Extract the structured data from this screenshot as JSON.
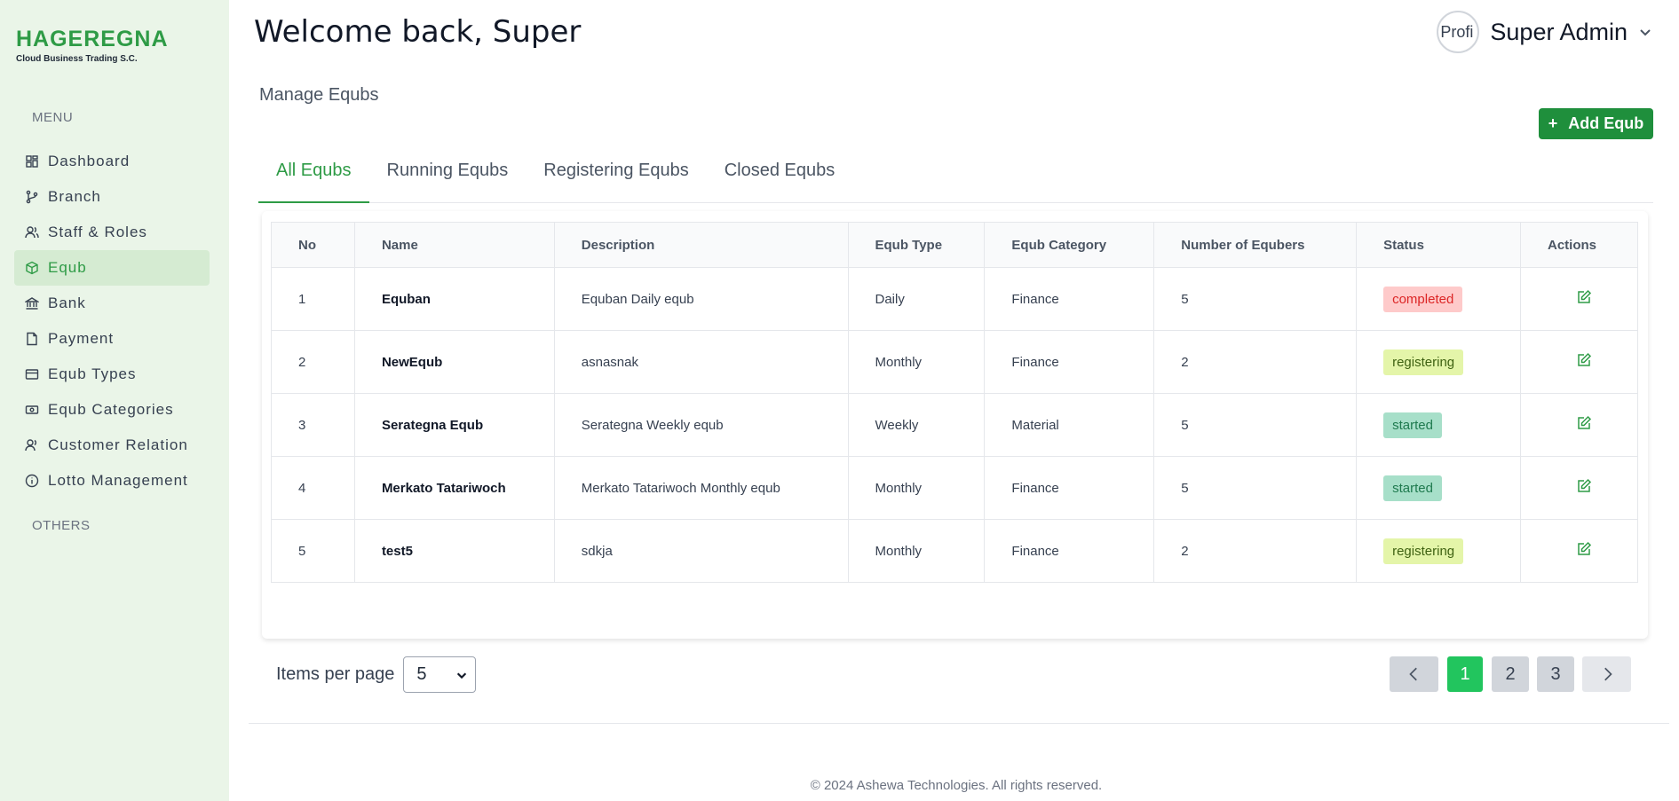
{
  "brand": {
    "name": "HAGEREGNA",
    "tagline": "Cloud  Business Trading S.C.",
    "color": "#2e9b46"
  },
  "sidebar": {
    "menu_heading": "MENU",
    "others_heading": "OTHERS",
    "items": [
      {
        "label": "Dashboard",
        "icon": "dashboard-icon"
      },
      {
        "label": "Branch",
        "icon": "branch-icon"
      },
      {
        "label": "Staff & Roles",
        "icon": "users-icon"
      },
      {
        "label": "Equb",
        "icon": "box-icon",
        "active": true
      },
      {
        "label": "Bank",
        "icon": "bank-icon"
      },
      {
        "label": "Payment",
        "icon": "document-icon"
      },
      {
        "label": "Equb Types",
        "icon": "card-icon"
      },
      {
        "label": "Equb Categories",
        "icon": "money-icon"
      },
      {
        "label": "Customer Relation",
        "icon": "user-icon"
      },
      {
        "label": "Lotto Management",
        "icon": "info-icon"
      }
    ]
  },
  "header": {
    "welcome": "Welcome back, Super",
    "profile_name": "Super Admin",
    "avatar_alt": "Profi"
  },
  "page": {
    "title": "Manage Equbs",
    "add_button": "Add Equb",
    "tabs": [
      "All Equbs",
      "Running Equbs",
      "Registering Equbs",
      "Closed Equbs"
    ]
  },
  "table": {
    "columns": [
      "No",
      "Name",
      "Description",
      "Equb Type",
      "Equb Category",
      "Number of Equbers",
      "Status",
      "Actions"
    ],
    "rows": [
      {
        "no": "1",
        "name": "Equban",
        "description": "Equban Daily equb",
        "type": "Daily",
        "category": "Finance",
        "count": "5",
        "status": "completed"
      },
      {
        "no": "2",
        "name": "NewEqub",
        "description": "asnasnak",
        "type": "Monthly",
        "category": "Finance",
        "count": "2",
        "status": "registering"
      },
      {
        "no": "3",
        "name": "Serategna Equb",
        "description": "Serategna Weekly equb",
        "type": "Weekly",
        "category": "Material",
        "count": "5",
        "status": "started"
      },
      {
        "no": "4",
        "name": "Merkato Tatariwoch",
        "description": "Merkato Tatariwoch Monthly equb",
        "type": "Monthly",
        "category": "Finance",
        "count": "5",
        "status": "started"
      },
      {
        "no": "5",
        "name": "test5",
        "description": "sdkja",
        "type": "Monthly",
        "category": "Finance",
        "count": "2",
        "status": "registering"
      }
    ]
  },
  "pagination": {
    "items_per_page_label": "Items per page",
    "items_per_page_value": "5",
    "pages": [
      "1",
      "2",
      "3"
    ],
    "current_page": "1"
  },
  "footer": {
    "text": "© 2024 Ashewa Technologies. All rights reserved."
  }
}
